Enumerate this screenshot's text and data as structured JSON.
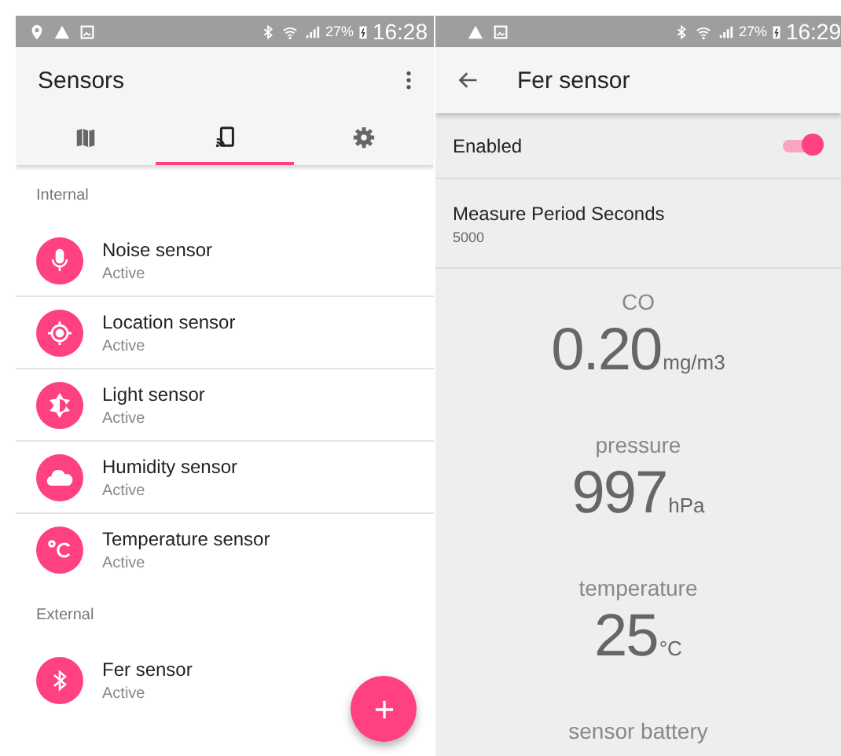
{
  "left_screen": {
    "status_bar": {
      "battery": "27%",
      "time": "16:28"
    },
    "app_bar": {
      "title": "Sensors"
    },
    "tabs": [
      {
        "kind": "map",
        "selected": false
      },
      {
        "kind": "cast",
        "selected": true
      },
      {
        "kind": "settings",
        "selected": false
      }
    ],
    "sections": [
      {
        "header": "Internal",
        "items": [
          {
            "kind": "noise",
            "name": "Noise sensor",
            "status": "Active"
          },
          {
            "kind": "location",
            "name": "Location sensor",
            "status": "Active"
          },
          {
            "kind": "light",
            "name": "Light sensor",
            "status": "Active"
          },
          {
            "kind": "humidity",
            "name": "Humidity sensor",
            "status": "Active"
          },
          {
            "kind": "temperature",
            "name": "Temperature sensor",
            "status": "Active"
          }
        ]
      },
      {
        "header": "External",
        "items": [
          {
            "kind": "bluetooth",
            "name": "Fer sensor",
            "status": "Active"
          }
        ]
      }
    ]
  },
  "right_screen": {
    "status_bar": {
      "battery": "27%",
      "time": "16:29"
    },
    "app_bar": {
      "title": "Fer sensor"
    },
    "enabled": {
      "label": "Enabled",
      "on": true
    },
    "measure_period": {
      "label": "Measure Period Seconds",
      "value": "5000"
    },
    "readings": [
      {
        "label": "CO",
        "value": "0.20",
        "unit": "mg/m3"
      },
      {
        "label": "pressure",
        "value": "997",
        "unit": "hPa"
      },
      {
        "label": "temperature",
        "value": "25",
        "unit": "°C"
      },
      {
        "label": "sensor battery"
      }
    ]
  }
}
